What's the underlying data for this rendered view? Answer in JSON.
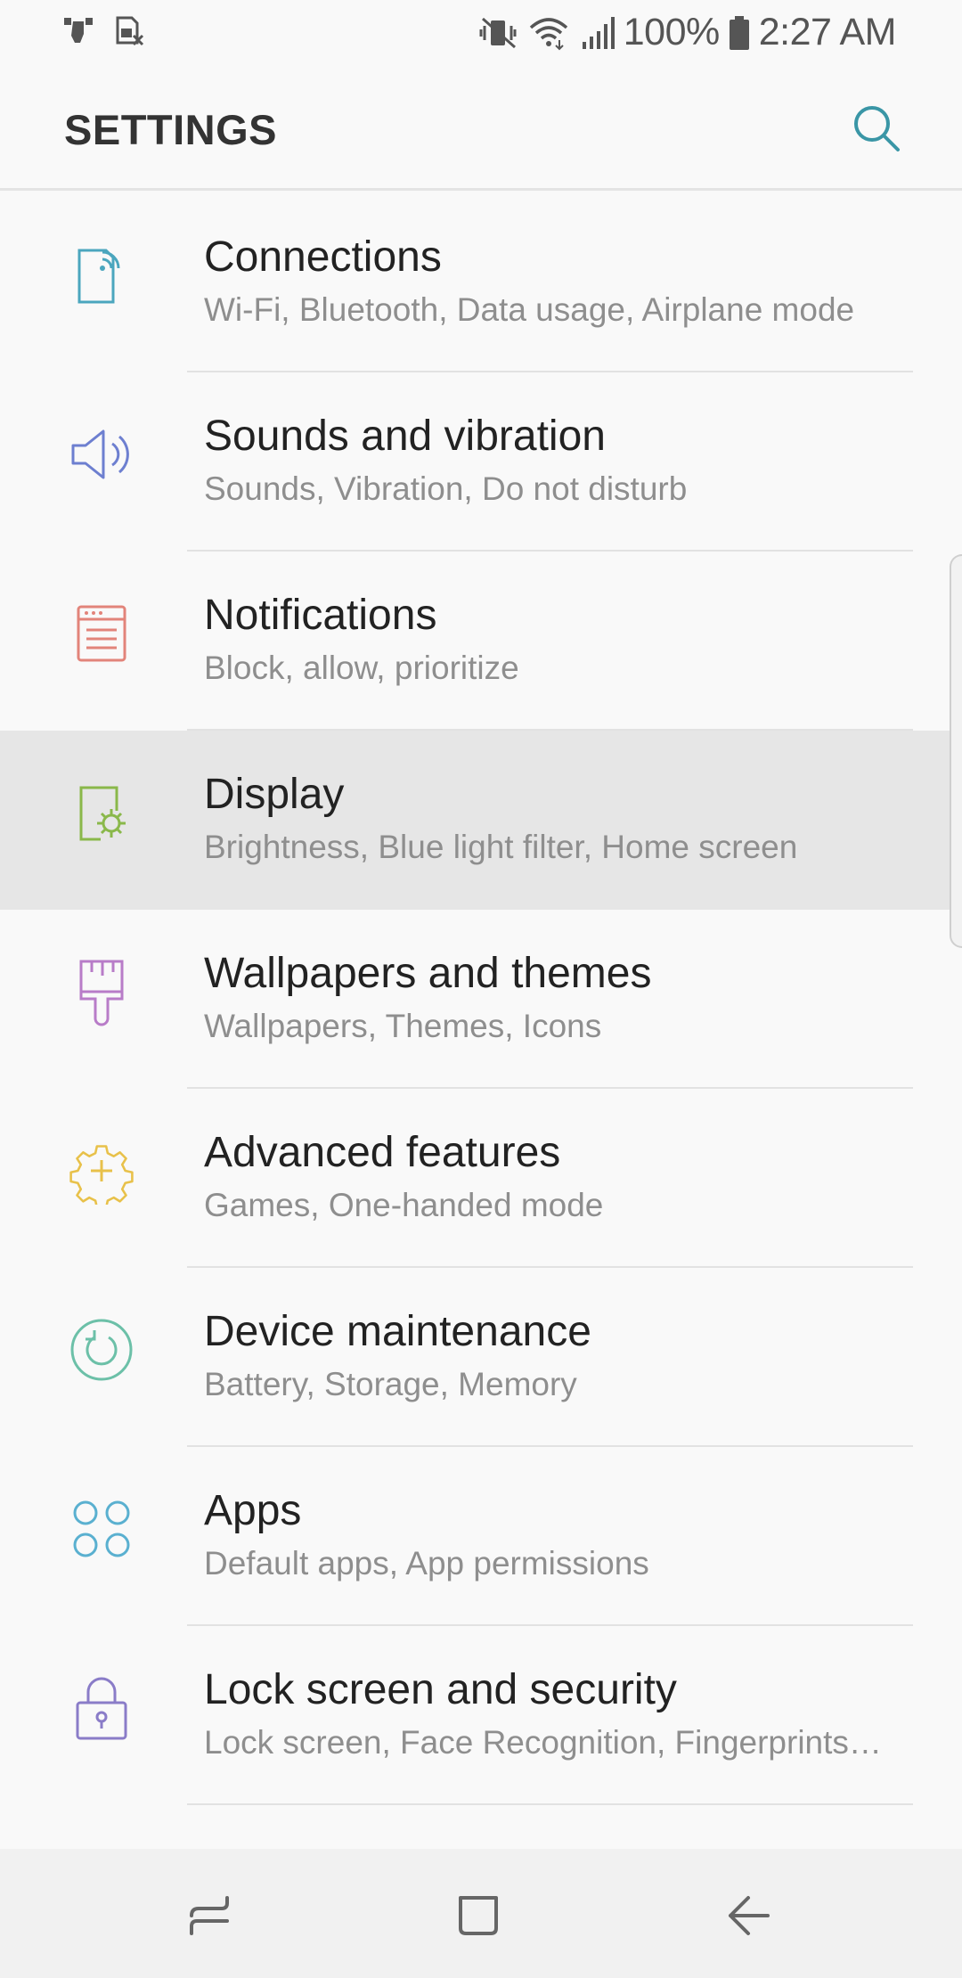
{
  "status_bar": {
    "battery_percent": "100%",
    "time": "2:27 AM",
    "left_icons": [
      "finger-tap-icon",
      "sim-off-icon"
    ],
    "right_icons": [
      "mute-vibrate-icon",
      "wifi-icon",
      "signal-icon",
      "battery-icon"
    ]
  },
  "app_bar": {
    "title": "SETTINGS",
    "search_icon": "search-icon",
    "accent_color": "#3a96a6"
  },
  "settings_items": [
    {
      "title": "Connections",
      "subtitle": "Wi-Fi, Bluetooth, Data usage, Airplane mode",
      "icon": "connections-icon",
      "color": "#4ba6be"
    },
    {
      "title": "Sounds and vibration",
      "subtitle": "Sounds, Vibration, Do not disturb",
      "icon": "speaker-icon",
      "color": "#6d7fd0"
    },
    {
      "title": "Notifications",
      "subtitle": "Block, allow, prioritize",
      "icon": "notifications-icon",
      "color": "#e2847a"
    },
    {
      "title": "Display",
      "subtitle": "Brightness, Blue light filter, Home screen",
      "icon": "display-brightness-icon",
      "color": "#8ab84a",
      "highlighted": true
    },
    {
      "title": "Wallpapers and themes",
      "subtitle": "Wallpapers, Themes, Icons",
      "icon": "paintbrush-icon",
      "color": "#b87cc8"
    },
    {
      "title": "Advanced features",
      "subtitle": "Games, One-handed mode",
      "icon": "gear-plus-icon",
      "color": "#e8c14a"
    },
    {
      "title": "Device maintenance",
      "subtitle": "Battery, Storage, Memory",
      "icon": "refresh-circle-icon",
      "color": "#6cc0a8"
    },
    {
      "title": "Apps",
      "subtitle": "Default apps, App permissions",
      "icon": "apps-grid-icon",
      "color": "#5ab0d0"
    },
    {
      "title": "Lock screen and security",
      "subtitle": "Lock screen, Face Recognition, Fingerprints…",
      "icon": "lock-icon",
      "color": "#8a7cc8"
    }
  ],
  "nav_bar": {
    "buttons": [
      "recents-icon",
      "home-icon",
      "back-icon"
    ]
  }
}
